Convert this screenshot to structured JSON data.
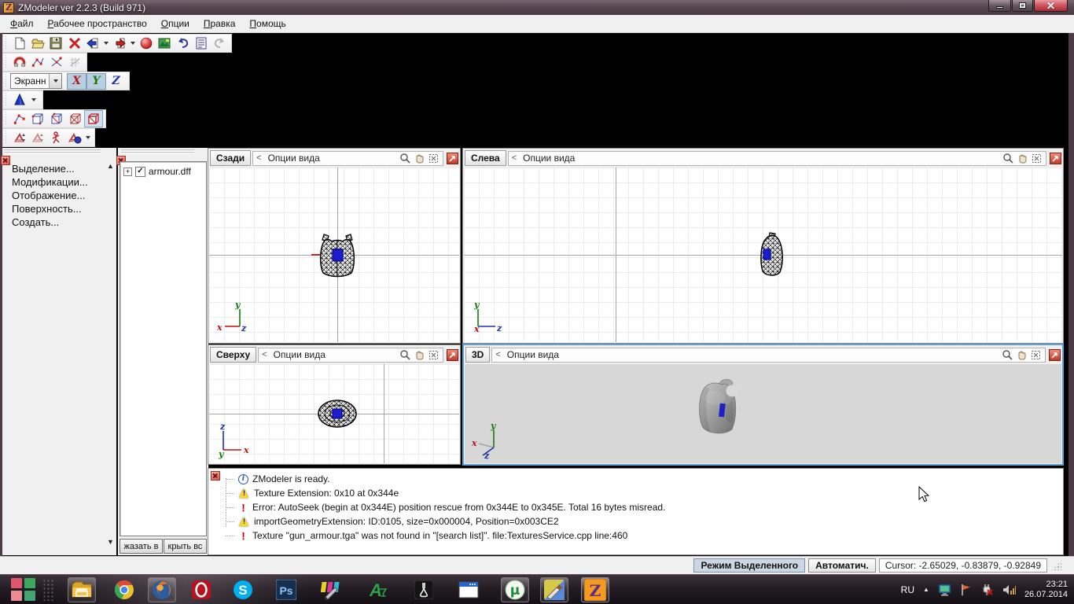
{
  "window": {
    "title": "ZModeler ver 2.2.3 (Build 971)",
    "logo_letter": "Z"
  },
  "menu": {
    "items": [
      "Файл",
      "Рабочее пространство",
      "Опции",
      "Правка",
      "Помощь"
    ]
  },
  "axis_toolbar": {
    "space_dropdown_value": "Экранн",
    "x": "X",
    "y": "Y",
    "z": "Z"
  },
  "sidebar": {
    "items": [
      "Выделение...",
      "Модификации...",
      "Отображение...",
      "Поверхность...",
      "Создать..."
    ]
  },
  "scene_tree": {
    "root_item": "armour.dff",
    "show_all_button": "жазать в",
    "hide_all_button": "крыть вс"
  },
  "viewports": {
    "collapse_char": "<",
    "options_label": "Опции вида",
    "back_label": "Сзади",
    "left_label": "Слева",
    "top_label": "Сверху",
    "threed_label": "3D"
  },
  "gizmo": {
    "x": "x",
    "y": "y",
    "z": "z"
  },
  "log": {
    "messages": [
      {
        "level": "info",
        "text": "ZModeler is ready."
      },
      {
        "level": "warning",
        "text": "Texture Extension: 0x10 at 0x344e"
      },
      {
        "level": "error",
        "text": "Error: AutoSeek (begin at 0x344E) position rescue  from 0x344E to 0x345E. Total 16 bytes misread."
      },
      {
        "level": "warning",
        "text": "importGeometryExtension: ID:0105, size=0x000004, Position=0x003CE2"
      },
      {
        "level": "error",
        "text": "Texture \"gun_armour.tga\" was not found in \"[search list]\". file:TexturesService.cpp line:460"
      }
    ]
  },
  "status_bar": {
    "mode_button": "Режим Выделенного",
    "auto_button": "Автоматич.",
    "cursor_readout": "Cursor: -2.65029, -0.83879, -0.92849"
  },
  "taskbar": {
    "icon_letters": {
      "skype": "S",
      "photoshop": "Ps",
      "aimp": "A",
      "utorrent": "µ",
      "zmodeler": "Z"
    },
    "tray": {
      "language": "RU",
      "time": "23:21",
      "date": "26.07.2014"
    }
  },
  "icons": {
    "check": "✓",
    "plus": "+",
    "scroll_up": "▲",
    "scroll_down": "▼",
    "tray_up": "▲",
    "info_glyph": "i",
    "warn_glyph": "!",
    "error_glyph": "!"
  },
  "colors": {
    "active_viewport_border": "#5aa2dc",
    "selection_blue": "#1d1dd0",
    "titlebar": "#584752",
    "zmodeler_orange": "#f59a1e",
    "error_red": "#d00000",
    "warning_yellow": "#ffd81a"
  }
}
